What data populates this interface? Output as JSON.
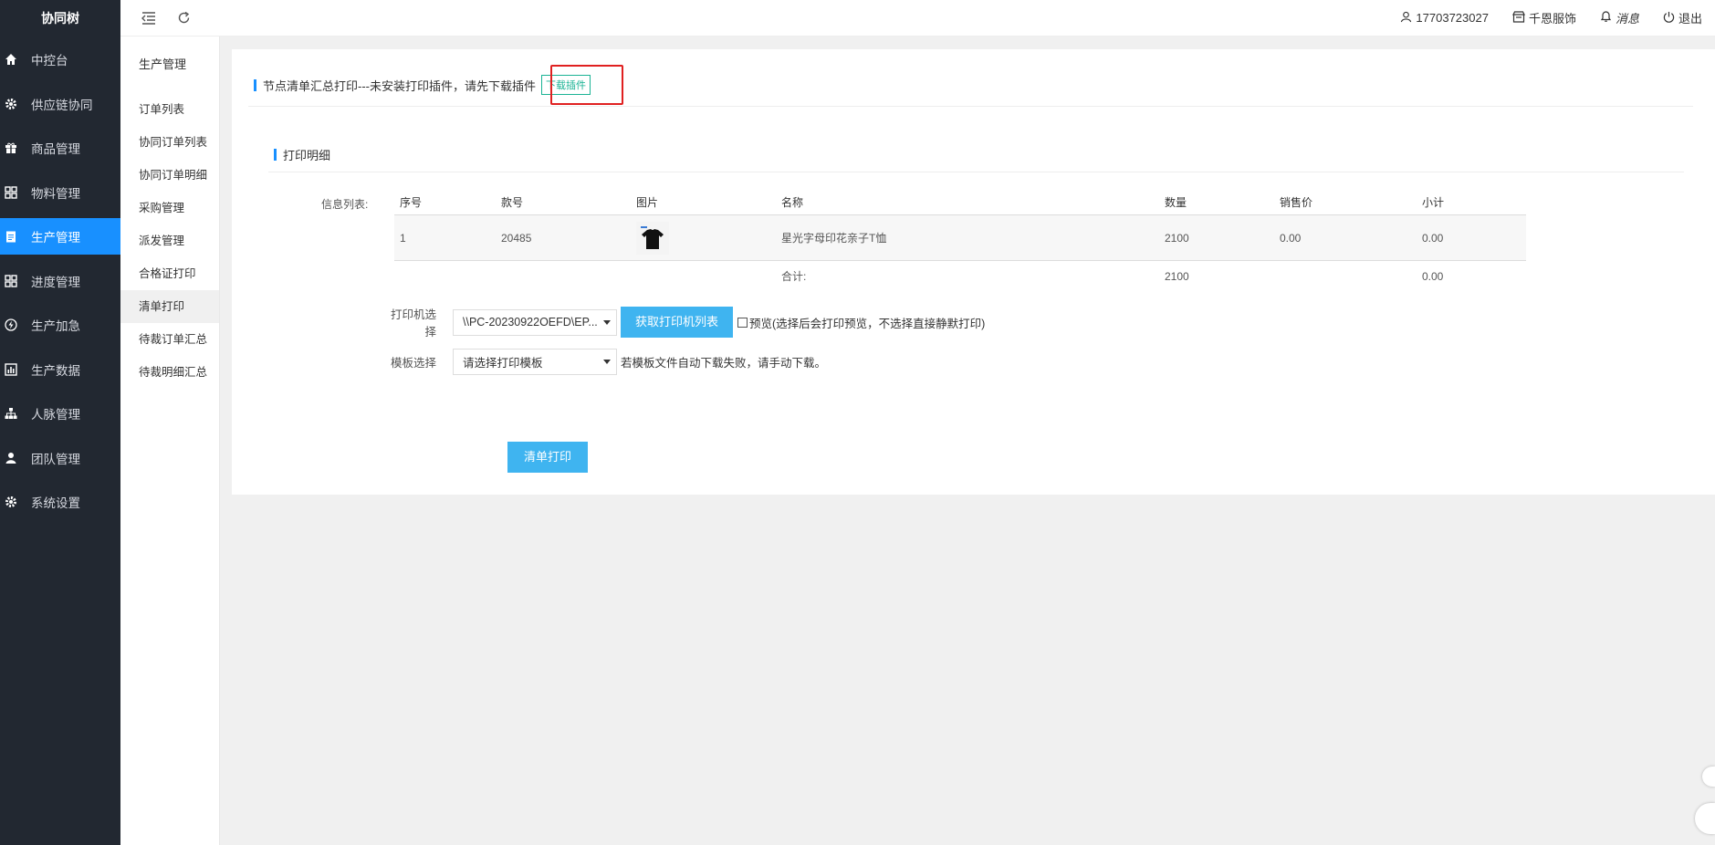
{
  "app": {
    "brand": "协同树"
  },
  "sidebar": {
    "items": [
      {
        "label": "中控台",
        "icon": "home-icon",
        "active": false
      },
      {
        "label": "供应链协同",
        "icon": "gear-icon",
        "active": false
      },
      {
        "label": "商品管理",
        "icon": "gift-icon",
        "active": false
      },
      {
        "label": "物料管理",
        "icon": "grid-icon",
        "active": false
      },
      {
        "label": "生产管理",
        "icon": "clipboard-icon",
        "active": true
      },
      {
        "label": "进度管理",
        "icon": "grid-icon",
        "active": false
      },
      {
        "label": "生产加急",
        "icon": "bolt-icon",
        "active": false
      },
      {
        "label": "生产数据",
        "icon": "chart-icon",
        "active": false
      },
      {
        "label": "人脉管理",
        "icon": "network-icon",
        "active": false
      },
      {
        "label": "团队管理",
        "icon": "user-icon",
        "active": false
      },
      {
        "label": "系统设置",
        "icon": "gear-icon",
        "active": false
      }
    ]
  },
  "submenu": {
    "title": "生产管理",
    "items": [
      {
        "label": "订单列表",
        "active": false
      },
      {
        "label": "协同订单列表",
        "active": false
      },
      {
        "label": "协同订单明细",
        "active": false
      },
      {
        "label": "采购管理",
        "active": false
      },
      {
        "label": "派发管理",
        "active": false
      },
      {
        "label": "合格证打印",
        "active": false
      },
      {
        "label": "清单打印",
        "active": true
      },
      {
        "label": "待裁订单汇总",
        "active": false
      },
      {
        "label": "待裁明细汇总",
        "active": false
      }
    ]
  },
  "topbar": {
    "phone": "17703723027",
    "shop": "千恩服饰",
    "messages": "消息",
    "logout": "退出"
  },
  "main": {
    "notice": "节点清单汇总打印---未安装打印插件，请先下载插件",
    "download_label": "下载插件",
    "section_title": "打印明细",
    "info_label": "信息列表:",
    "table": {
      "headers": [
        "序号",
        "款号",
        "图片",
        "名称",
        "数量",
        "销售价",
        "小计"
      ],
      "rows": [
        {
          "index": "1",
          "style_no": "20485",
          "image": "black-tshirt-image",
          "name": "星光字母印花亲子T恤",
          "qty": "2100",
          "price": "0.00",
          "subtotal": "0.00"
        }
      ],
      "total": {
        "label": "合计:",
        "qty": "2100",
        "subtotal": "0.00"
      }
    },
    "printer": {
      "label": "打印机选择",
      "value": "\\\\PC-20230922OEFD\\EP...",
      "fetch_button": "获取打印机列表",
      "preview_text": "预览(选择后会打印预览，不选择直接静默打印)"
    },
    "template": {
      "label": "模板选择",
      "value": "请选择打印模板",
      "hint": "若模板文件自动下载失败，请手动下载。"
    },
    "print_button": "清单打印"
  },
  "colors": {
    "accent": "#1890ff",
    "button": "#3fb4f0",
    "sidebar_bg": "#222831",
    "highlight_box": "#e02020"
  }
}
